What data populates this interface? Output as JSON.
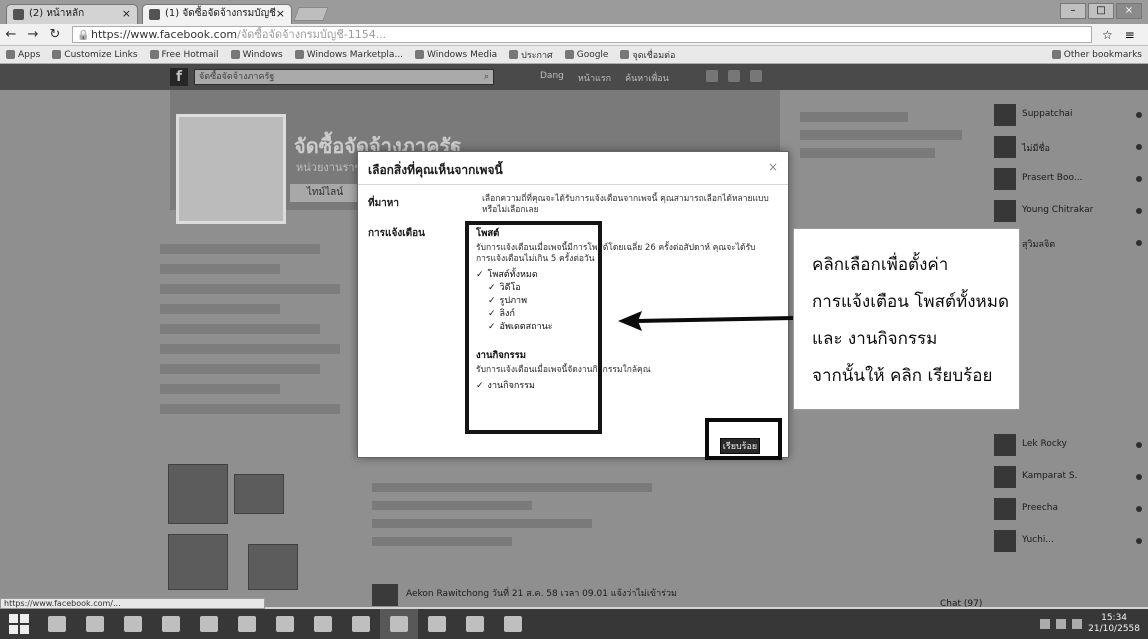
{
  "browser": {
    "tabs": [
      {
        "label": "(2) หน้าหลัก"
      },
      {
        "label": "(1) จัดซื้อจัดจ้างกรมบัญชี"
      }
    ],
    "url_host": "https://www.facebook.com",
    "url_rest": "/จัดซื้อจัดจ้างกรมบัญชี-1154...",
    "bookmarks": [
      "Apps",
      "Customize Links",
      "Free Hotmail",
      "Windows",
      "Windows Marketpla...",
      "Windows Media",
      "ประกาศ",
      "Google",
      "จุดเชื่อมต่อ",
      "Other bookmarks"
    ]
  },
  "facebook": {
    "logo": "f",
    "search_placeholder": "จัดซื้อจัดจ้างภาครัฐ",
    "nav": [
      "Dang",
      "หน้าแรก",
      "ค้นหาเพื่อน"
    ],
    "page_name": "จัดซื้อจัดจ้างภาครัฐ",
    "page_subtitle": "หน่วยงานราชการ",
    "page_tab": "ไทม์ไลน์",
    "contacts": [
      {
        "name": "Suppatchai"
      },
      {
        "name": "ไม่มีชื่อ"
      },
      {
        "name": "Prasert Boo..."
      },
      {
        "name": "Young Chitrakar"
      },
      {
        "name": "สุวิมลจิต"
      },
      {
        "name": "Lek Rocky"
      },
      {
        "name": "Kamparat S."
      },
      {
        "name": "Preecha"
      },
      {
        "name": "Yuchi..."
      }
    ],
    "post_author_line": "Aekon Rawitchong วันที่ 21 ส.ค. 58 เวลา 09.01 แจ้งว่าไม่เข้าร่วม",
    "chat_status": "Chat (97)"
  },
  "dialog": {
    "title": "เลือกสิ่งที่คุณเห็นจากเพจนี้",
    "close_symbol": "×",
    "label_prefs": "ที่มาหา",
    "prefs_text": "เลือกความถี่ที่คุณจะได้รับการแจ้งเตือนจากเพจนี้ คุณสามารถเลือกได้หลายแบบหรือไม่เลือกเลย",
    "label_notifications": "การแจ้งเตือน",
    "posts_title": "โพสต์",
    "posts_text": "รับการแจ้งเตือนเมื่อเพจนี้มีการโพสต์โดยเฉลี่ย 26 ครั้งต่อสัปดาห์ คุณจะได้รับการแจ้งเตือนไม่เกิน 5 ครั้งต่อวัน",
    "post_options": [
      {
        "label": "โพสต์ทั้งหมด",
        "checked": true,
        "level": 0
      },
      {
        "label": "วิดีโอ",
        "checked": true,
        "level": 1
      },
      {
        "label": "รูปภาพ",
        "checked": true,
        "level": 1
      },
      {
        "label": "ลิงก์",
        "checked": true,
        "level": 1
      },
      {
        "label": "อัพเดตสถานะ",
        "checked": true,
        "level": 1
      }
    ],
    "events_title": "งานกิจกรรม",
    "events_text": "รับการแจ้งเตือนเมื่อเพจนี้จัดงานกิจกรรมใกล้คุณ",
    "event_options": [
      {
        "label": "งานกิจกรรม",
        "checked": true
      }
    ],
    "done_label": "เรียบร้อย",
    "check_symbol": "✓"
  },
  "annotation": {
    "lines": [
      "คลิกเลือกเพื่อตั้งค่า",
      "การแจ้งเตือน โพสต์ทั้งหมด",
      "และ งานกิจกรรม",
      "จากนั้นให้ คลิก เรียบร้อย"
    ]
  },
  "statusbar": {
    "url": "https://www.facebook.com/..."
  },
  "taskbar": {
    "time": "15:34",
    "date": "21/10/2558"
  }
}
